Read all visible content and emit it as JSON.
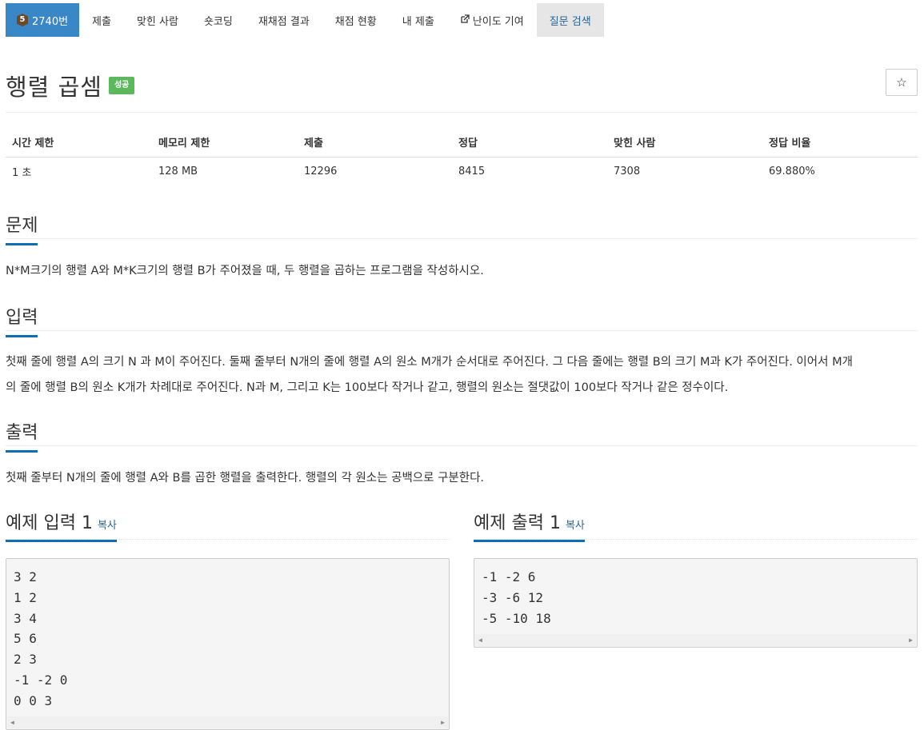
{
  "nav": {
    "problem_number": "2740번",
    "tier": "5",
    "tabs": [
      "제출",
      "맞힌 사람",
      "숏코딩",
      "재채점 결과",
      "채점 현황",
      "내 제출"
    ],
    "difficulty": "난이도 기여",
    "question_search": "질문 검색"
  },
  "problem": {
    "title": "행렬 곱셈",
    "result_badge": "성공",
    "star": "☆"
  },
  "info": {
    "headers": [
      "시간 제한",
      "메모리 제한",
      "제출",
      "정답",
      "맞힌 사람",
      "정답 비율"
    ],
    "values": [
      "1 초",
      "128 MB",
      "12296",
      "8415",
      "7308",
      "69.880%"
    ]
  },
  "sections": {
    "problem_heading": "문제",
    "problem_text": "N*M크기의 행렬 A와 M*K크기의 행렬 B가 주어졌을 때, 두 행렬을 곱하는 프로그램을 작성하시오.",
    "input_heading": "입력",
    "input_text_1": "첫째 줄에 행렬 A의 크기 N 과 M이 주어진다. 둘째 줄부터 N개의 줄에 행렬 A의 원소 M개가 순서대로 주어진다. 그 다음 줄에는 행렬 B의 크기 M과 K가 주어진다. 이어서 M개",
    "input_text_2": "의 줄에 행렬 B의 원소 K개가 차례대로 주어진다. N과 M, 그리고 K는 100보다 작거나 같고, 행렬의 원소는 절댓값이 100보다 작거나 같은 정수이다.",
    "output_heading": "출력",
    "output_text": "첫째 줄부터 N개의 줄에 행렬 A와 B를 곱한 행렬을 출력한다. 행렬의 각 원소는 공백으로 구분한다."
  },
  "samples": {
    "input_heading": "예제 입력 1",
    "output_heading": "예제 출력 1",
    "copy": "복사",
    "input_lines": [
      "3 2",
      "1 2",
      "3 4",
      "5 6",
      "2 3",
      "-1 -2 0",
      "0 0 3"
    ],
    "output_lines": [
      "-1 -2 6",
      "-3 -6 12",
      "-5 -10 18"
    ]
  },
  "colors": {
    "active_tab": "#3a87c8",
    "success": "#5cb85c",
    "heading_underline": "#0d6eb4",
    "link": "#2a6496"
  }
}
